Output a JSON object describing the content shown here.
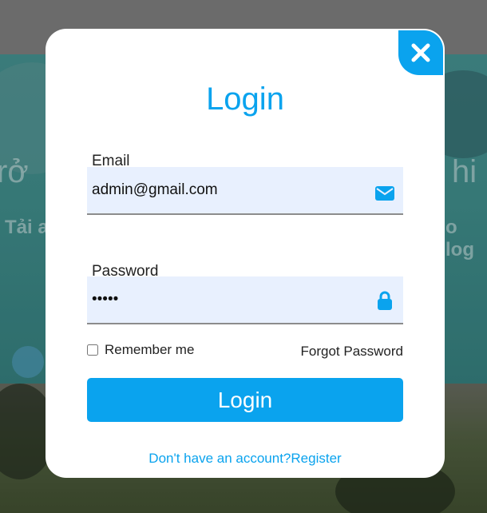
{
  "background": {
    "hero_text_left": "rở",
    "hero_text_right": "hi",
    "sub_text_left": "Tải a",
    "sub_text_right": "o log"
  },
  "modal": {
    "title": "Login",
    "email": {
      "label": "Email",
      "value": "admin@gmail.com",
      "icon": "envelope-icon"
    },
    "password": {
      "label": "Password",
      "value": "•••••",
      "icon": "lock-icon"
    },
    "remember_label": "Remember me",
    "forgot_label": "Forgot Password",
    "login_button": "Login",
    "register": {
      "prompt": "Don't have an account?",
      "link": "Register"
    },
    "close_icon": "close-icon"
  },
  "colors": {
    "accent": "#0aa3ee",
    "field_bg": "#e8f0fe"
  }
}
